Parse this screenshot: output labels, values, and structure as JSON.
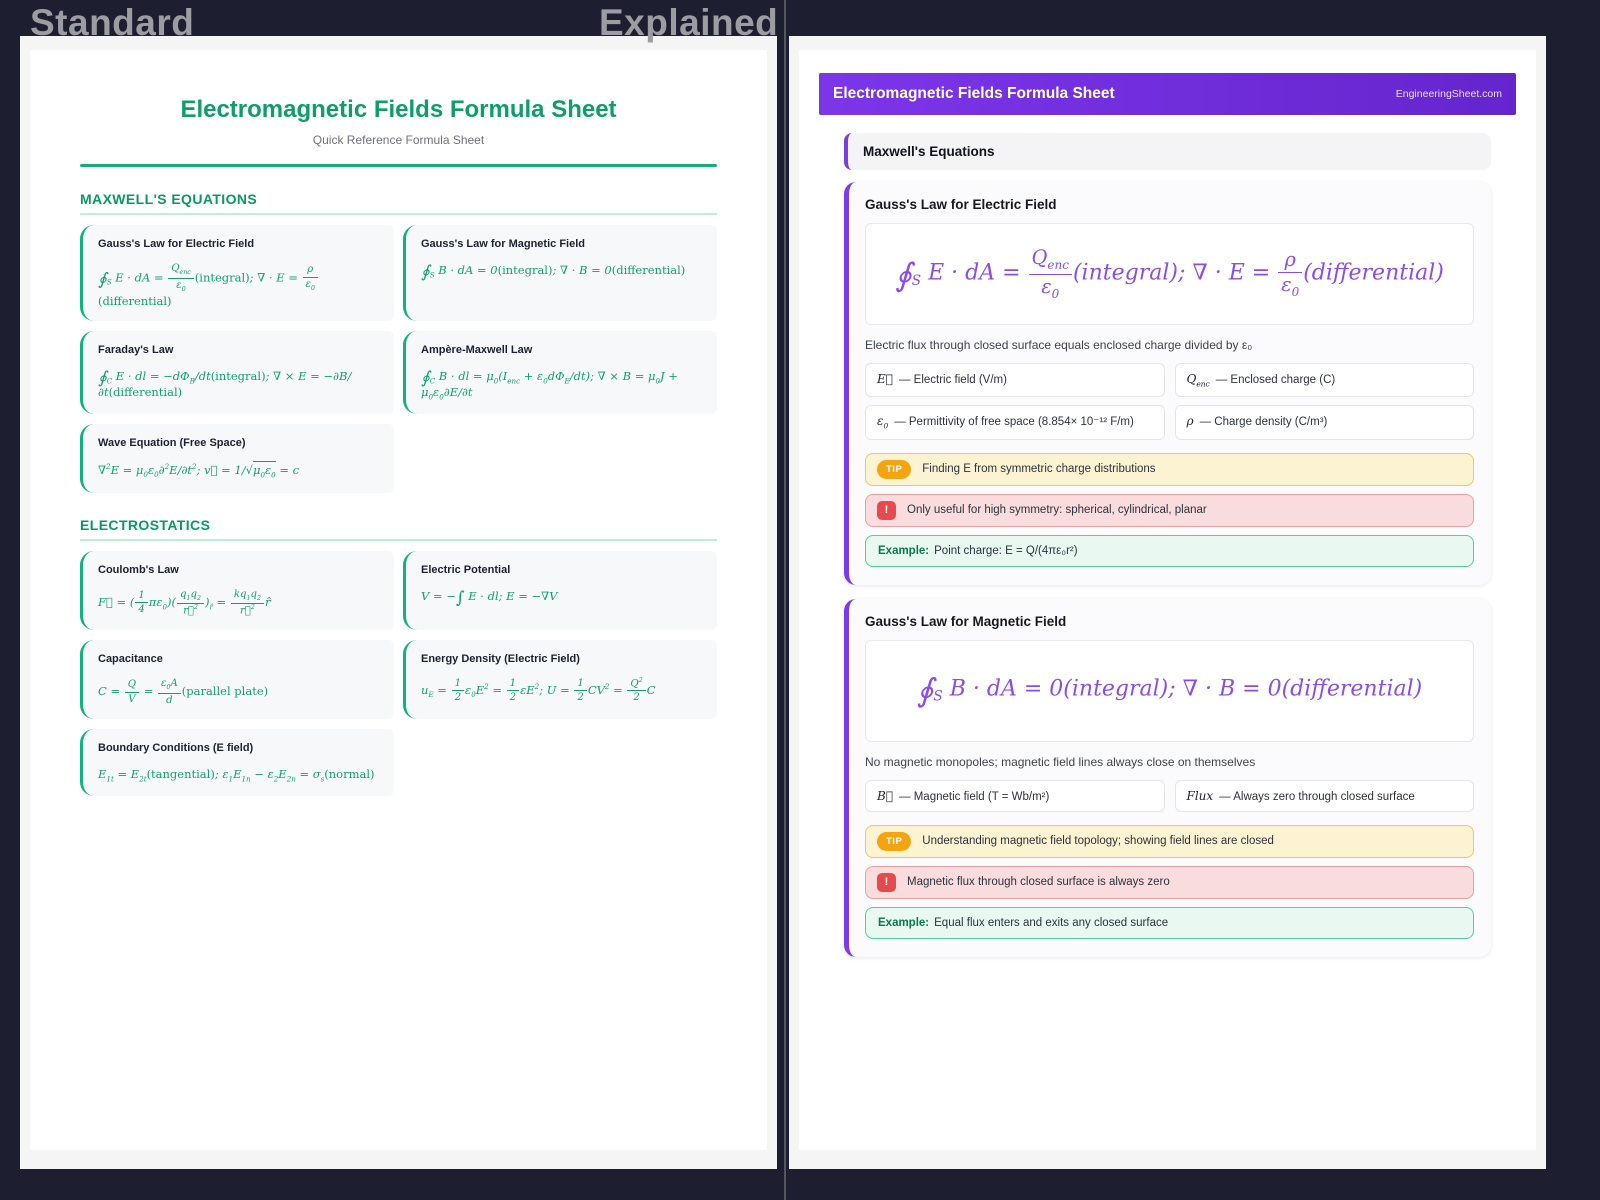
{
  "comparison": {
    "left_label": "Standard",
    "right_label": "Explained"
  },
  "colors": {
    "background_dark": "#1e1e31",
    "accent_green": "#10b981",
    "accent_purple": "#7c3aed",
    "tip_orange": "#f59e0b",
    "warning_red": "#ef4444",
    "example_green": "#34d399"
  },
  "left_panel": {
    "title": "Electromagnetic Fields Formula Sheet",
    "subtitle": "Quick Reference Formula Sheet",
    "sections": [
      {
        "heading": "MAXWELL'S EQUATIONS",
        "cards": [
          {
            "title": "Gauss's Law for Electric Field",
            "formula": "∮_{S} E · dA = \\frac{Q_{enc}}{ε_{0}}\\rm{(integral)}; ∇ · E = \\frac{ρ}{ε_{0}}\\rm{(differential)}"
          },
          {
            "title": "Gauss's Law for Magnetic Field",
            "formula": "∮_{S} B · dA = 0\\rm{(integral)}; ∇ · B = 0\\rm{(differential)}"
          },
          {
            "title": "Faraday's Law",
            "formula": "∮_{C} E · dl = −dΦ_{B}/dt\\rm{(integral)}; ∇ × E = −∂B/∂t\\rm{(differential)}"
          },
          {
            "title": "Ampère-Maxwell Law",
            "formula": "∮_{C} B · dl = μ_{0}(I_{enc} + ε_{0}dΦ_{E}/dt); ∇ × B = μ_{0}J + μ_{0}ε_{0}∂E/∂t"
          },
          {
            "title": "Wave Equation (Free Space)",
            "formula": "∇^{2}E = μ_{0}ε_{0}∂^{2}E/∂t^{2}; v⃗ = 1/\\sqrt{μ_{0}ε_{0}} = c"
          }
        ]
      },
      {
        "heading": "ELECTROSTATICS",
        "cards": [
          {
            "title": "Coulomb's Law",
            "formula": "F⃗ = (\\frac{1}{4}πε_{0})(\\frac{q_{1}q_{2}}{r⃗^{2}})_{r̂} = \\frac{kq_{1}q_{2}}{r⃗^{2}}r̂"
          },
          {
            "title": "Electric Potential",
            "formula": "V = −∫ E · dl; E = −∇V"
          },
          {
            "title": "Capacitance",
            "formula": "C = \\frac{Q}{V} = \\frac{ε_{0}A}{d}\\rm{(parallel plate)}"
          },
          {
            "title": "Energy Density (Electric Field)",
            "formula": "u_{E} = \\frac{1}{2}ε_{0}E^{2} = \\frac{1}{2}εE^{2}; U = \\frac{1}{2}CV^{2} = \\frac{Q^{2}}{2}C"
          },
          {
            "title": "Boundary Conditions (E field)",
            "formula": "E_{1t} = E_{2t}\\rm{(tangential)}; ε_{1}E_{1n} − ε_{2}E_{2n} = σ_{s}\\rm{(normal)}"
          }
        ]
      }
    ]
  },
  "right_panel": {
    "header": {
      "title": "Electromagnetic Fields Formula Sheet",
      "brand": "EngineeringSheet.com"
    },
    "section_heading": "Maxwell's Equations",
    "cards": [
      {
        "title": "Gauss's Law for Electric Field",
        "equation": "∮_{S} E · dA = \\frac{Q_{enc}}{ε_{0}}(integral); ∇ · E = \\frac{ρ}{ε_{0}}(differential)",
        "description": "Electric flux through closed surface equals enclosed charge divided by ε₀",
        "variables": [
          {
            "symbol": "E⃗",
            "meaning": "— Electric field (V/m)"
          },
          {
            "symbol": "Q_{enc}",
            "meaning": "— Enclosed charge (C)"
          },
          {
            "symbol": "ε_{0}",
            "meaning": "— Permittivity of free space (8.854× 10⁻¹² F/m)"
          },
          {
            "symbol": "ρ",
            "meaning": "— Charge density (C/m³)"
          }
        ],
        "tip_label": "TIP",
        "tip": "Finding E from symmetric charge distributions",
        "warning_icon": "!",
        "warning": "Only useful for high symmetry: spherical, cylindrical, planar",
        "example_label": "Example:",
        "example": "Point charge: E = Q/(4πε₀r²)"
      },
      {
        "title": "Gauss's Law for Magnetic Field",
        "equation": "∮_{S} B · dA = 0(integral); ∇ · B = 0(differential)",
        "description": "No magnetic monopoles; magnetic field lines always close on themselves",
        "variables": [
          {
            "symbol": "B⃗",
            "meaning": "— Magnetic field (T = Wb/m²)"
          },
          {
            "symbol": "Flux",
            "meaning": "— Always zero through closed surface"
          }
        ],
        "tip_label": "TIP",
        "tip": "Understanding magnetic field topology; showing field lines are closed",
        "warning_icon": "!",
        "warning": "Magnetic flux through closed surface is always zero",
        "example_label": "Example:",
        "example": "Equal flux enters and exits any closed surface"
      }
    ]
  }
}
